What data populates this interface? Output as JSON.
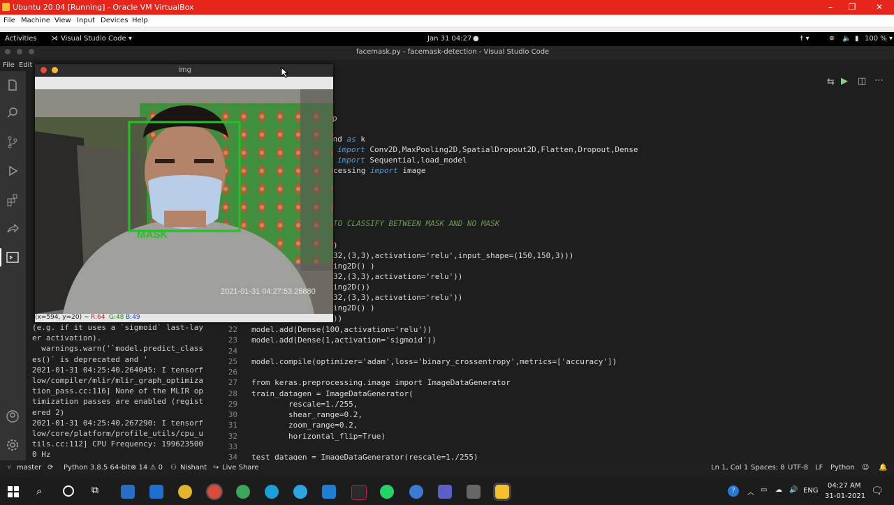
{
  "vbox": {
    "title": "Ubuntu 20.04 [Running] - Oracle VM VirtualBox",
    "menu": [
      "File",
      "Machine",
      "View",
      "Input",
      "Devices",
      "Help"
    ],
    "controls": [
      "–",
      "❐",
      "✕"
    ]
  },
  "gnome": {
    "activities": "Activities",
    "app": "Visual Studio Code ▾",
    "clock": "Jan 31  04:27",
    "battery": "100 % ▾"
  },
  "vscode": {
    "window_title": "facemask.py - facemask-detection - Visual Studio Code",
    "menu": [
      "File",
      "Edit"
    ]
  },
  "img_window": {
    "title": "img",
    "face_label": "MASK",
    "timestamp": "2021-01-31  04:27:53.26880",
    "status_coords": "(x=594, y=20) ~ ",
    "status_r": "R:64",
    "status_g": "G:48",
    "status_b": "B:49"
  },
  "terminal_lines": [
    "(e.g. if it uses a `sigmoid` last-lay",
    "er activation).",
    "  warnings.warn('`model.predict_class",
    "es()` is deprecated and '",
    "2021-01-31 04:25:40.264045: I tensorf",
    "low/compiler/mlir/mlir_graph_optimiza",
    "tion_pass.cc:116] None of the MLIR op",
    "timization passes are enabled (regist",
    "ered 2)",
    "2021-01-31 04:25:40.267290: I tensorf",
    "low/core/platform/profile_utils/cpu_u",
    "tils.cc:112] CPU Frequency: 199623500",
    "0 Hz"
  ],
  "code_fragments": {
    "p": "p",
    "l_backend_a": "end ",
    "l_backend_b": "as",
    "l_backend_c": " k",
    "l_layers_kw": "import",
    "l_layers": " Conv2D,MaxPooling2D,SpatialDropout2D,Flatten,Dropout,Dense",
    "l_models_kw": "import",
    "l_models": " Sequential,load_model",
    "l_proc_a": "cessing ",
    "l_proc_kw": "import",
    "l_proc_b": " image",
    "l_comment": "TO CLASSIFY BETWEEN MASK AND NO MASK",
    "f1": ")",
    "f2": "32,(3,3),activation='relu',input_shape=(150,150,3)))",
    "f3": "ing2D() )",
    "f4": "32,(3,3),activation='relu'))",
    "f5": "ing2D())",
    "f6": "32,(3,3),activation='relu'))",
    "f7": "ing2D() )",
    "f8": "))"
  },
  "code_lines": [
    {
      "n": "22",
      "text": "model.add(Dense(100,activation='relu'))"
    },
    {
      "n": "23",
      "text": "model.add(Dense(1,activation='sigmoid'))"
    },
    {
      "n": "24",
      "text": ""
    },
    {
      "n": "25",
      "text": "model.compile(optimizer='adam',loss='binary_crossentropy',metrics=['accuracy'])"
    },
    {
      "n": "26",
      "text": ""
    },
    {
      "n": "27",
      "text": "from keras.preprocessing.image import ImageDataGenerator"
    },
    {
      "n": "28",
      "text": "train_datagen = ImageDataGenerator("
    },
    {
      "n": "29",
      "text": "        rescale=1./255,"
    },
    {
      "n": "30",
      "text": "        shear_range=0.2,"
    },
    {
      "n": "31",
      "text": "        zoom_range=0.2,"
    },
    {
      "n": "32",
      "text": "        horizontal_flip=True)"
    },
    {
      "n": "33",
      "text": ""
    },
    {
      "n": "34",
      "text": "test_datagen = ImageDataGenerator(rescale=1./255)"
    }
  ],
  "status": {
    "branch": "master",
    "python": "Python 3.8.5 64-bit",
    "problems": "⊗ 14 ⚠ 0",
    "user": "Nishant",
    "liveshare": "Live Share",
    "position": "Ln 1, Col 1",
    "spaces": "Spaces: 8",
    "encoding": "UTF-8",
    "eol": "LF",
    "language": "Python"
  },
  "taskbar": {
    "lang": "ENG",
    "time": "04:27 AM",
    "date": "31-01-2021"
  },
  "colors": {
    "vbox_red": "#e8251a",
    "box_green": "#22c322",
    "status_r": "#d02020",
    "status_g": "#118811",
    "status_b": "#1a3ed0"
  }
}
